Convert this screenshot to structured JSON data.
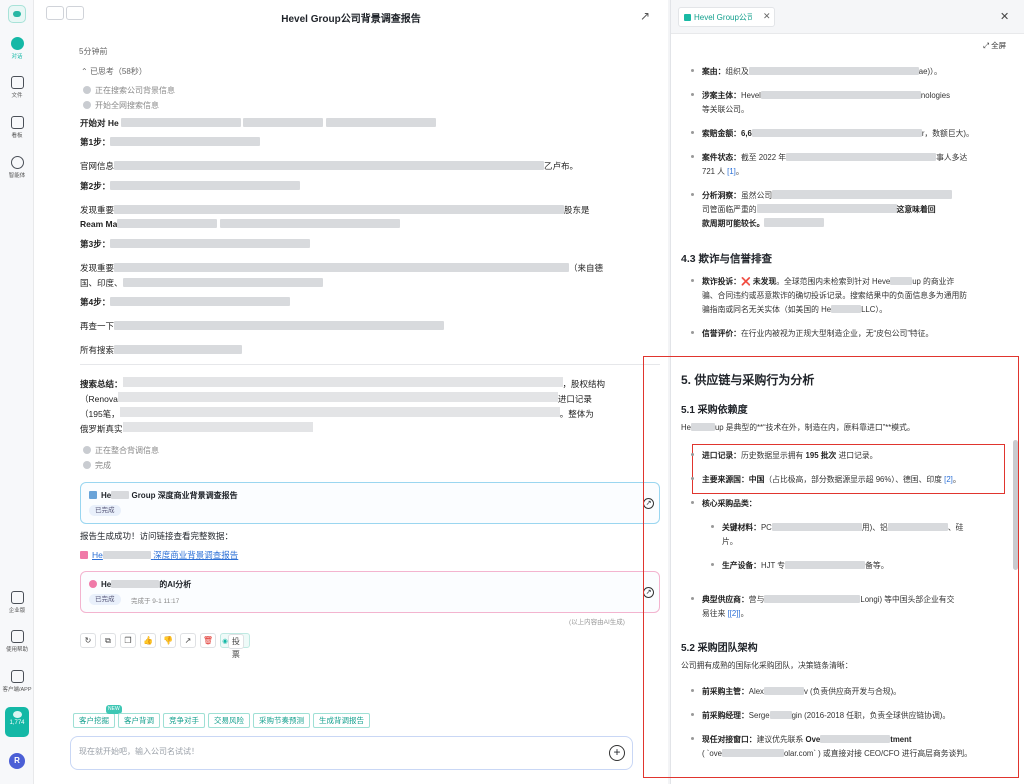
{
  "sidebar": {
    "items": [
      {
        "label": "对话"
      },
      {
        "label": "文件"
      },
      {
        "label": "看板"
      },
      {
        "label": "智能体"
      }
    ],
    "bottom": [
      {
        "label": "企业版"
      },
      {
        "label": "使用帮助"
      },
      {
        "label": "客户端/APP"
      }
    ],
    "credits": "1,774",
    "avatar": "R"
  },
  "chat": {
    "title": "Hevel Group公司背景调查报告",
    "time_ago": "5分钟前",
    "thinking": "已思考（58秒）",
    "steps_top": [
      "正在搜索公司背景信息",
      "开始全网搜索信息"
    ],
    "lines": {
      "start": "开始对 He",
      "step1": "第1步：",
      "official": "官网信息",
      "official_tail": "乙卢布。",
      "step2": "第2步：",
      "found1": "发现重要",
      "found1_tail": "股东是",
      "ream": "Ream Ma",
      "step3": "第3步：",
      "found2": "发现重要",
      "found2_tail": "（来自德",
      "found2_l2": "国、印度、",
      "step4": "第4步：",
      "again": "再查一下",
      "all": "所有搜索"
    },
    "summary": {
      "label": "搜索总结：",
      "l1_tail": "，股权结构",
      "l2_head": "（Renova",
      "l2_tail": "进口记录",
      "l3_head": "（195笔，",
      "l3_tail": "。整体为",
      "l4_head": "俄罗斯真实"
    },
    "steps_bottom": [
      "正在整合背调信息",
      "完成"
    ],
    "report_card": {
      "prefix": "He",
      "suffix": "Group 深度商业背景调查报告",
      "status": "已完成"
    },
    "success_text": "报告生成成功！访问链接查看完整数据：",
    "link": {
      "prefix": "He",
      "suffix": "深度商业背景调查报告"
    },
    "ai_card": {
      "prefix": "He",
      "suffix": "的AI分析",
      "status": "已完成",
      "meta": "完成于 9-1 11:17"
    },
    "ai_disclaimer": "(以上内容由AI生成)",
    "vote_label": "投票",
    "chips": [
      "客户挖掘",
      "客户背调",
      "竞争对手",
      "交易风险",
      "采购节奏预测",
      "生成背调报告"
    ],
    "chip_new_badge": "NEW",
    "input_placeholder": "现在就开始吧，输入公司名试试！"
  },
  "report": {
    "tab_title": "Hevel Group公司背景调查报告",
    "fullscreen": "全屏",
    "bullets_top": [
      {
        "label": "案由：",
        "head": "组织及",
        "tail": "ae)）。"
      },
      {
        "label": "涉案主体：",
        "head": "Hevel",
        "tail": "nologies"
      },
      {
        "cont": "等关联公司。"
      },
      {
        "label": "索赔金额：",
        "head": "6,6",
        "tail": "r，数额巨大)。"
      },
      {
        "label": "案件状态：",
        "head": "截至 2022 年",
        "tail": "事人多达"
      },
      {
        "cont": "721 人",
        "ref": "[1]",
        "after": "。"
      },
      {
        "label": "分析洞察：",
        "head": "虽然公司"
      },
      {
        "cont": "司管面临严重的",
        "tail": "这意味着回"
      },
      {
        "cont": "款周期可能较长。"
      }
    ],
    "sec43": {
      "title": "4.3 欺诈与信誉排查",
      "fraud_label": "欺诈投诉：",
      "fraud_mark": "❌",
      "fraud_l1_bold": "未发现",
      "fraud_l1": "。全球范围内未检索到针对 Heve",
      "fraud_l1_tail": "up 的商业诈",
      "fraud_l2": "骗、合同违约或恶意欺诈的确切投诉记录。搜索结果中的负面信息多为通用防",
      "fraud_l3": "骗指南或同名无关实体（如美国的 He",
      "fraud_l3_tail": "LLC）。",
      "rep_label": "信誉评价：",
      "rep_text": "在行业内被视为正规大型制造企业，无“皮包公司”特征。"
    },
    "sec5": {
      "title": "5. 供应链与采购行为分析",
      "s51": "5.1 采购依赖度",
      "s51_p_head": "He",
      "s51_p_tail": "up 是典型的**“技术在外，制造在内，原料靠进口”**模式。",
      "import_label": "进口记录：",
      "import_text_a": "历史数据显示拥有 ",
      "import_bold": "195 批次",
      "import_text_b": " 进口记录。",
      "source_label": "主要来源国：",
      "source_bold": "中国",
      "source_text": "（占比极高，部分数据源显示超 96%）、德国、印度",
      "source_ref": "[2]",
      "source_end": "。",
      "core_label": "核心采购品类：",
      "mat_label": "关键材料：",
      "mat_head": "PC",
      "mat_tail": "用)、铝",
      "mat_tail2": "、硅",
      "mat_l2": "片。",
      "eq_label": "生产设备：",
      "eq_head": "HJT 专",
      "eq_tail": "备等。",
      "sup_label": "典型供应商：",
      "sup_head": "营与",
      "sup_tail": "Longi) 等中国头部企业有交",
      "sup_l2": "易往来",
      "sup_ref": "[[2]]",
      "sup_end": "。",
      "s52": "5.2 采购团队架构",
      "s52_p": "公司拥有成熟的国际化采购团队，决策链条清晰：",
      "head_label": "前采购主管：",
      "head_a": "Alex",
      "head_b": "v (负责供应商开发与合规)。",
      "mgr_label": "前采购经理：",
      "mgr_a": "Serge",
      "mgr_b": "gin (2016-2018 任职，负责全球供应链协调)。",
      "contact_label": "现任对接窗口：",
      "contact_a": "建议优先联系 ",
      "contact_bold_a": "Ove",
      "contact_bold_b": "tment",
      "contact_l2_a": "( `ove",
      "contact_l2_b": "olar.com` ) 或直接对接 CEO/CFO 进行高层商务谈判。"
    }
  },
  "colors": {
    "accent": "#14b8a6",
    "highlight_box": "#e0352e",
    "link": "#2b6fd6"
  }
}
